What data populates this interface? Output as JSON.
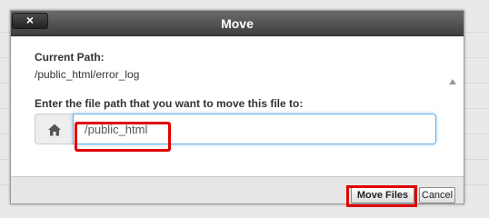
{
  "dialog": {
    "title": "Move",
    "close_label": "×"
  },
  "body": {
    "current_path_label": "Current Path:",
    "current_path_value": "/public_html/error_log",
    "instruction": "Enter the file path that you want to move this file to:",
    "path_input_value": "/public_html",
    "home_icon": "home-icon"
  },
  "footer": {
    "move_label": "Move Files",
    "cancel_label": "Cancel"
  },
  "colors": {
    "titlebar": "#4f4f4f",
    "highlight": "#e00000",
    "input_focus": "#66afe9"
  }
}
